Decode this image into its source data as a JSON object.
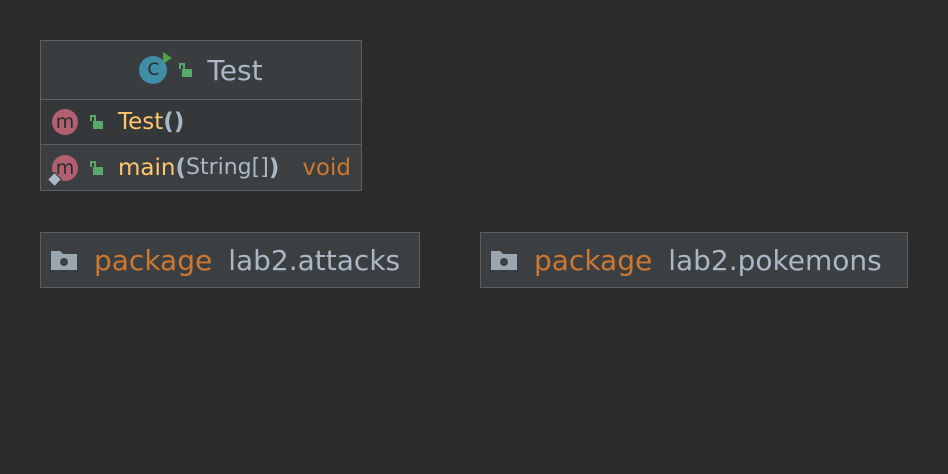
{
  "class": {
    "icon_letter": "C",
    "name": "Test",
    "members": [
      {
        "icon_letter": "m",
        "name": "Test",
        "open_paren": "(",
        "params": "",
        "close_paren": ")",
        "return_type": ""
      },
      {
        "icon_letter": "m",
        "name": "main",
        "open_paren": "(",
        "params": "String[]",
        "close_paren": ")",
        "return_type": "void"
      }
    ]
  },
  "packages": [
    {
      "keyword": "package",
      "name": "lab2.attacks"
    },
    {
      "keyword": "package",
      "name": "lab2.pokemons"
    }
  ],
  "colors": {
    "background": "#2b2b2b",
    "box": "#3c3f41",
    "border": "#5e6060",
    "keyword": "#cc7832",
    "method": "#ffc66d",
    "text": "#a9b7c6"
  },
  "icons": {
    "class": "class-icon",
    "method": "method-icon",
    "visibility": "public-lock-icon",
    "package": "folder-icon"
  }
}
